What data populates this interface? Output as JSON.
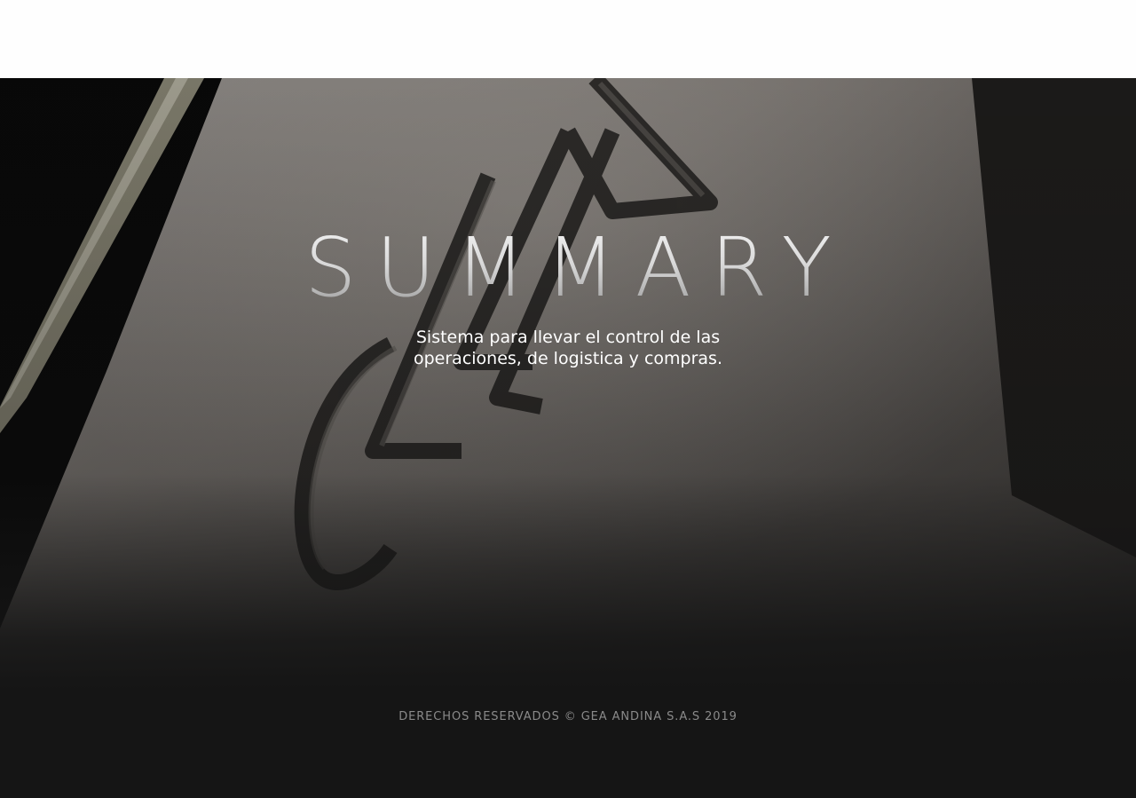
{
  "header": {},
  "hero": {
    "title": "SUMMARY",
    "subtitle": "Sistema para llevar el control de las operaciones, de logistica y compras.",
    "background_image": "gea-logo-sign-photo"
  },
  "footer": {
    "copyright": "DERECHOS RESERVADOS © GEA ANDINA S.A.S 2019"
  },
  "colors": {
    "header_bg": "#fefefe",
    "page_bg": "#151515",
    "title": "#e6e6e6",
    "subtitle": "#ffffff",
    "footer_text": "#8a8a8a"
  }
}
